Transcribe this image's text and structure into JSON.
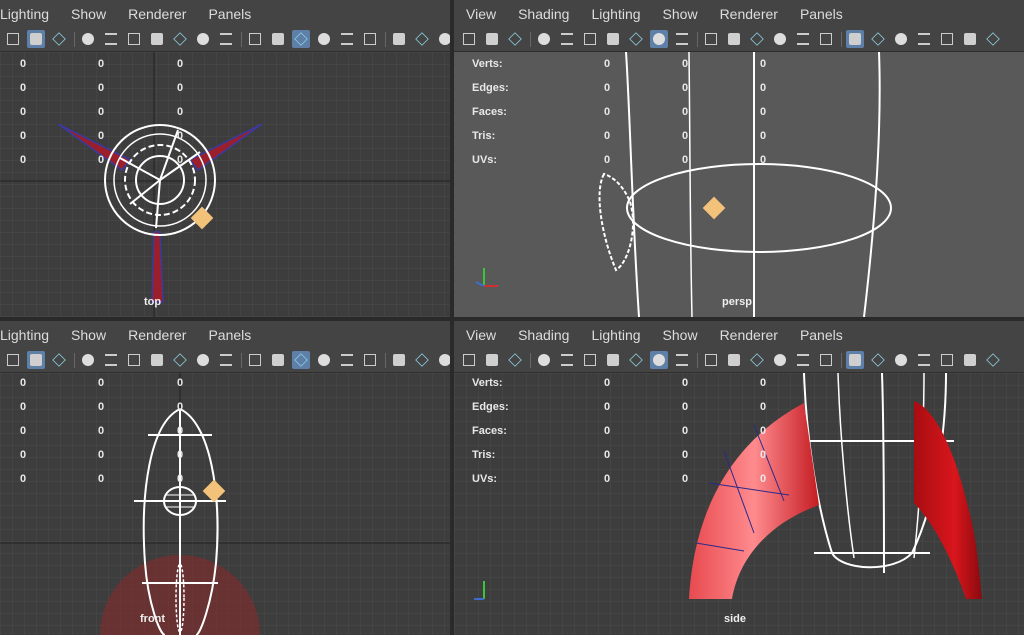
{
  "menus": {
    "top_left": [
      "Lighting",
      "Show",
      "Renderer",
      "Panels"
    ],
    "top_right": [
      "View",
      "Shading",
      "Lighting",
      "Show",
      "Renderer",
      "Panels"
    ],
    "bottom_left": [
      "Lighting",
      "Show",
      "Renderer",
      "Panels"
    ],
    "bottom_right": [
      "View",
      "Shading",
      "Lighting",
      "Show",
      "Renderer",
      "Panels"
    ]
  },
  "hud": {
    "labels": [
      "Verts:",
      "Edges:",
      "Faces:",
      "Tris:",
      "UVs:"
    ],
    "col_a": [
      "0",
      "0",
      "0",
      "0",
      "0"
    ],
    "col_b": [
      "0",
      "0",
      "0",
      "0",
      "0"
    ],
    "col_c": [
      "0",
      "0",
      "0",
      "0",
      "0"
    ]
  },
  "cameras": {
    "top": "top",
    "persp": "persp",
    "front": "front",
    "side": "side"
  },
  "axis": {
    "x": "x",
    "y": "y",
    "z": "z"
  },
  "colors": {
    "viewport_bg_ortho": "#3d3d3d",
    "viewport_bg_persp": "#5a5a5a",
    "grid": "#4a4a4a",
    "active_border": "#4e6fa8",
    "mesh_red": "#d9232a",
    "pivot": "#f3c27a"
  }
}
